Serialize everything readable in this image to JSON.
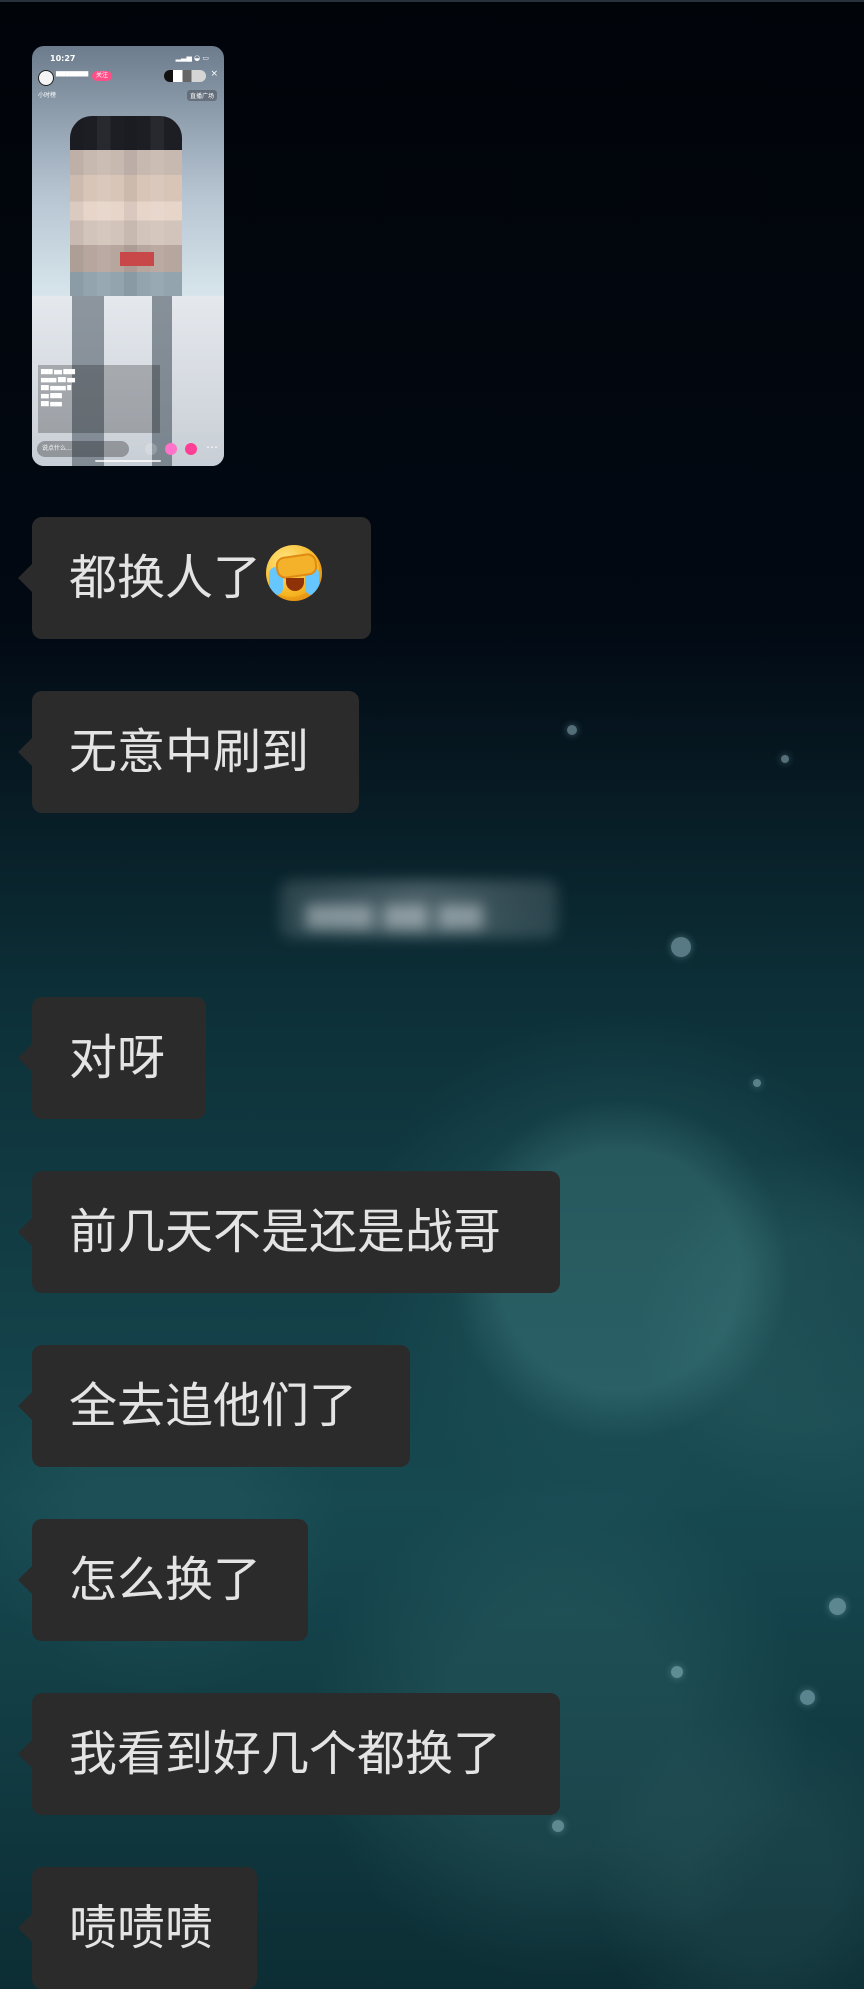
{
  "chat": {
    "messages": [
      {
        "text": "都换人了",
        "emoji": "face-with-tears-of-joy"
      },
      {
        "text": "无意中刷到"
      },
      {
        "text": "对呀"
      },
      {
        "text": "前几天不是还是战哥"
      },
      {
        "text": "全去追他们了"
      },
      {
        "text": "怎么换了"
      },
      {
        "text": "我看到好几个都换了"
      },
      {
        "text": "啧啧啧"
      }
    ]
  },
  "screenshot": {
    "time": "10:27",
    "follow": "关注",
    "small_tag": "小时榜",
    "plaza": "直播广场",
    "input_placeholder": "说点什么..."
  },
  "colors": {
    "bubble": "#2b2b2b",
    "text": "#e4e4e4",
    "background_top": "#010409",
    "background_bottom": "#174951"
  }
}
